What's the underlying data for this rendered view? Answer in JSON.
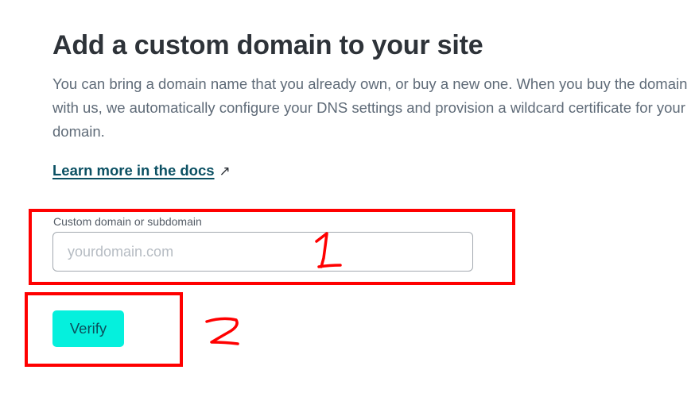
{
  "header": {
    "title": "Add a custom domain to your site"
  },
  "main": {
    "description": "You can bring a domain name that you already own, or buy a new one. When you buy the domain with us, we automatically configure your DNS settings and provision a wildcard certificate for your domain.",
    "docs_link": {
      "label": "Learn more in the docs",
      "icon": "external-arrow-icon",
      "glyph": "↗"
    },
    "domain_field": {
      "label": "Custom domain or subdomain",
      "placeholder": "yourdomain.com",
      "value": ""
    },
    "verify_button": {
      "label": "Verify",
      "color": "#05f0dd"
    }
  },
  "annotations": {
    "color": "#ff0000",
    "marks": [
      {
        "label": "1",
        "target": "domain_field"
      },
      {
        "label": "2",
        "target": "verify_button"
      }
    ]
  }
}
